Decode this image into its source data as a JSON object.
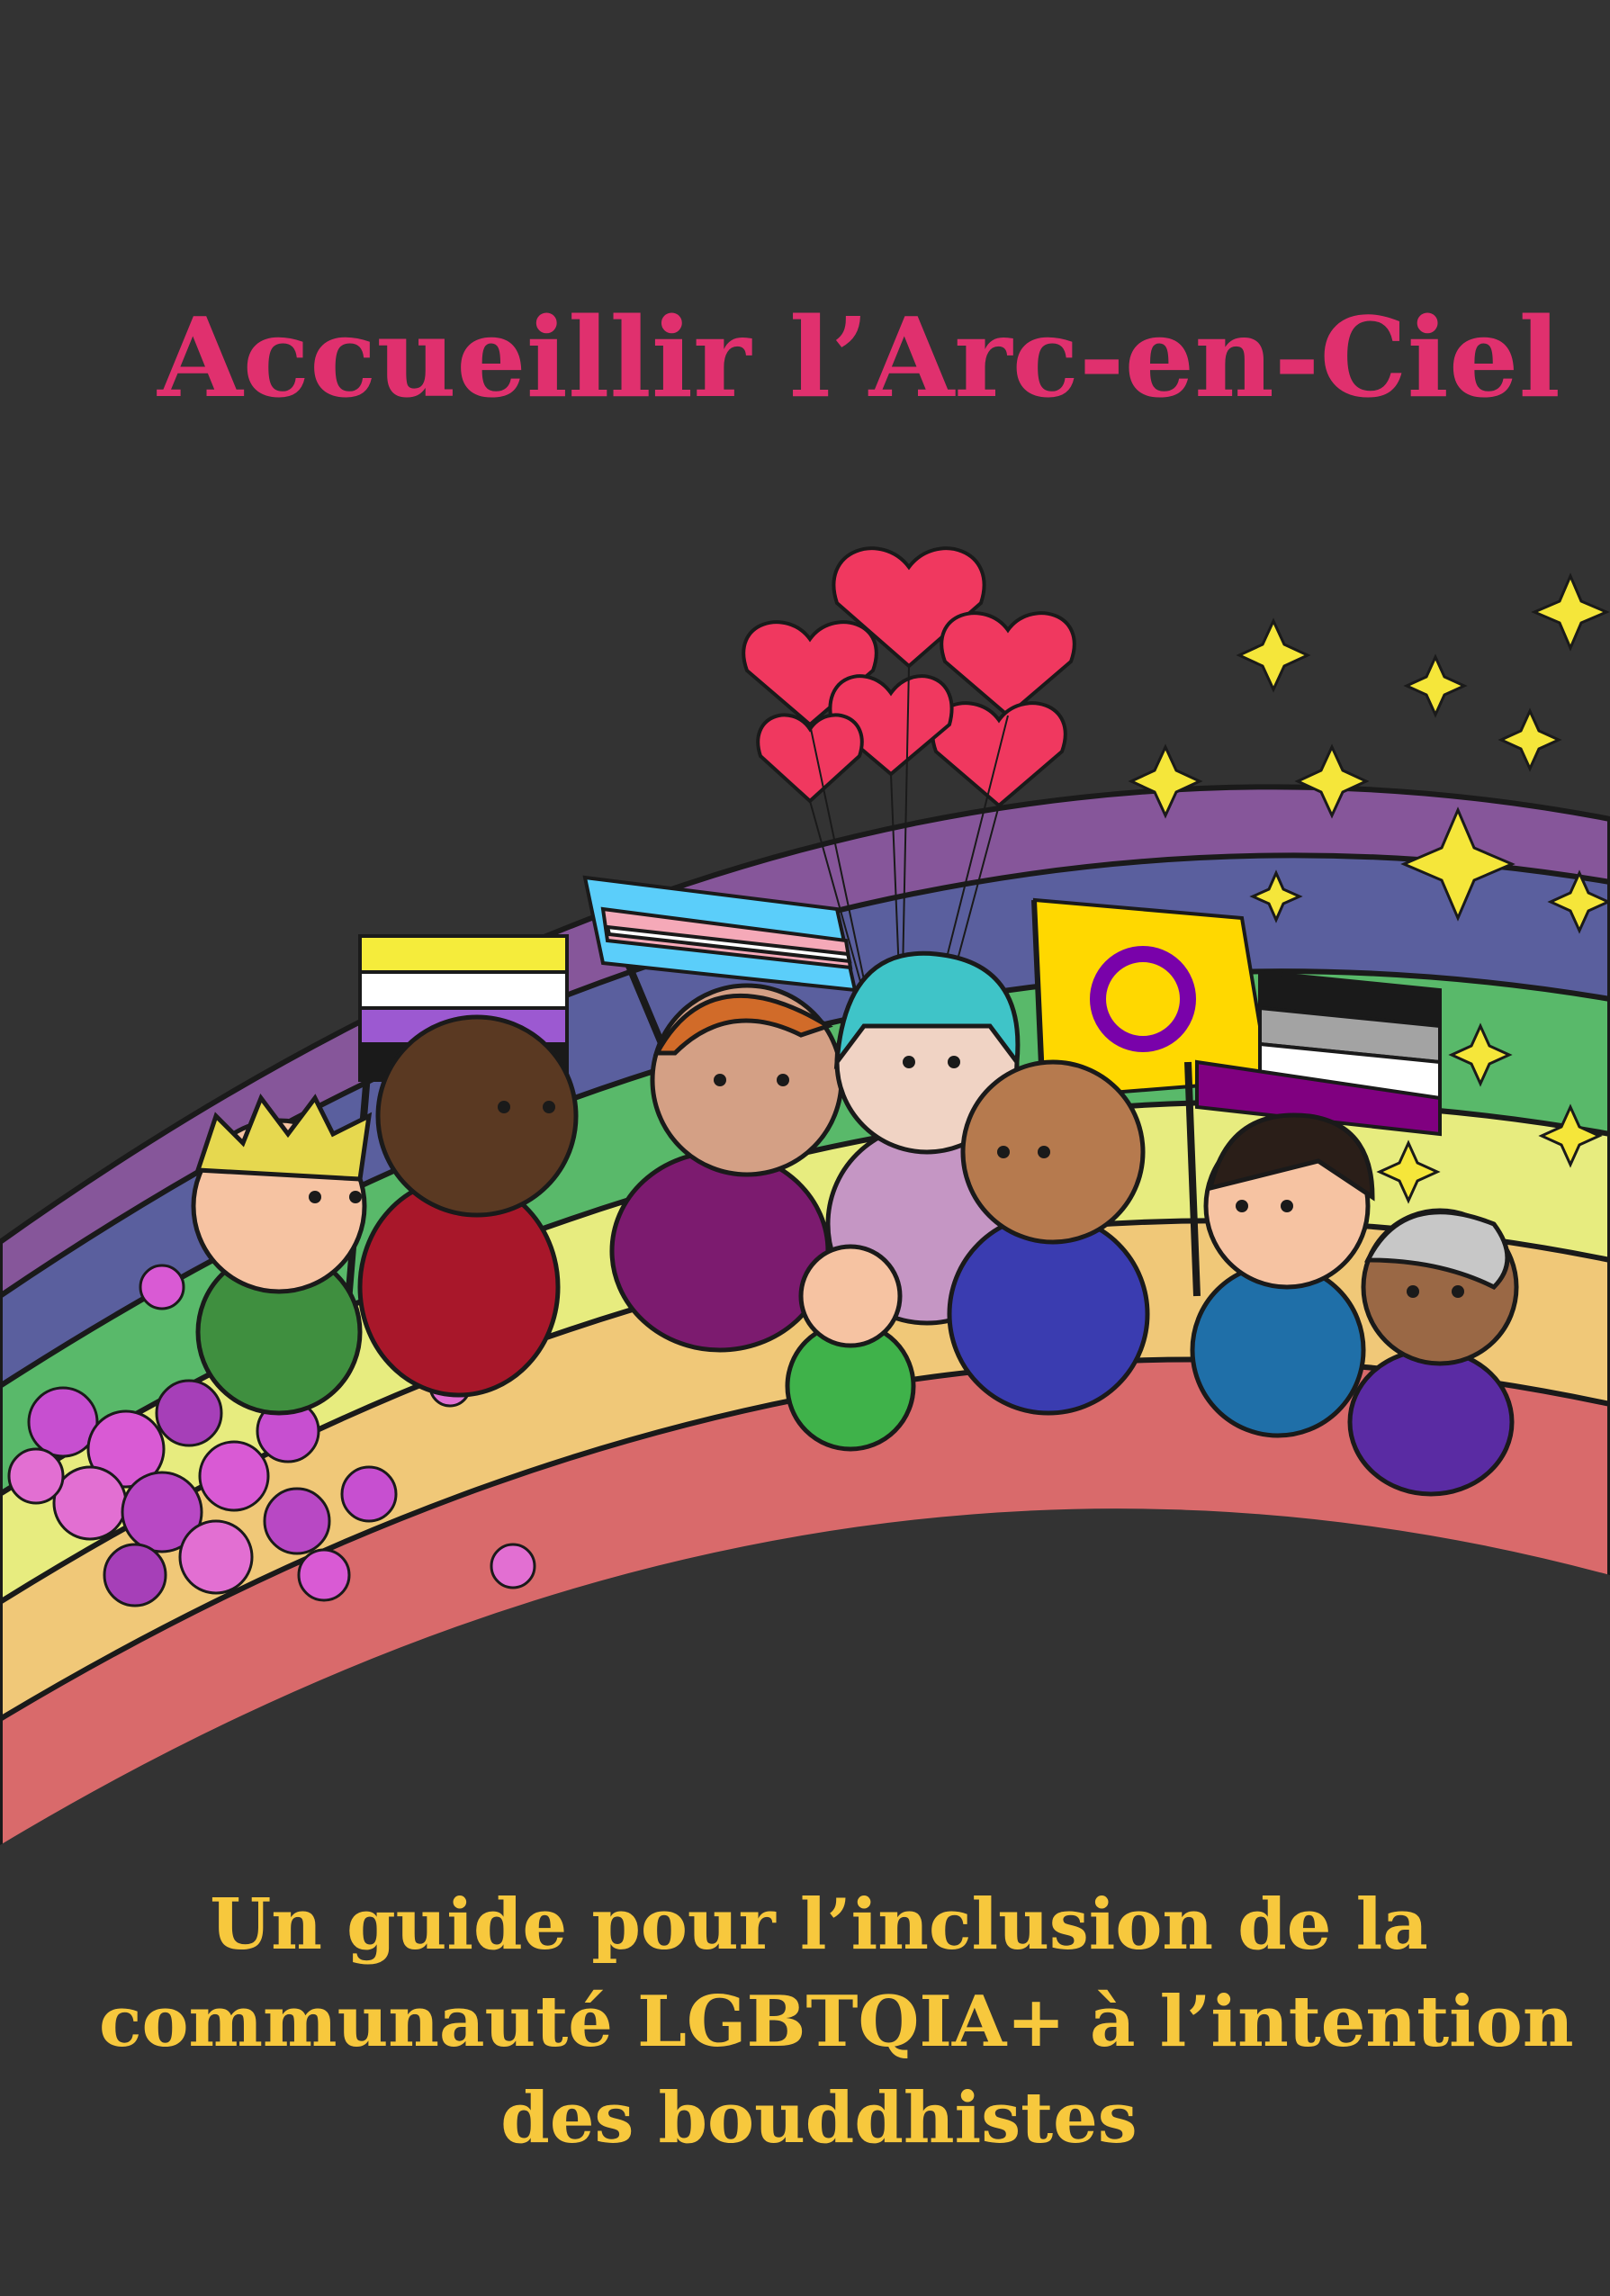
{
  "cover": {
    "title": "Accueillir l’Arc-en-Ciel",
    "subtitle_lines": [
      "Un guide pour l’inclusion de la",
      "communauté LGBTQIA+ à l’intention",
      "des bouddhistes"
    ]
  },
  "colors": {
    "background": "#333333",
    "title": "#e0306e",
    "subtitle": "#f7c83d",
    "rainbow": [
      "#86569a",
      "#5a5f9e",
      "#59b96a",
      "#e7ec7f",
      "#f0c878",
      "#d96a6b"
    ]
  },
  "illustration": {
    "icons": [
      "rainbow-arc",
      "people-group",
      "heart-balloons",
      "pride-flags",
      "stars",
      "flowers"
    ],
    "flags": [
      "nonbinary-flag",
      "transgender-flag",
      "intersex-flag",
      "asexual-flag"
    ]
  }
}
